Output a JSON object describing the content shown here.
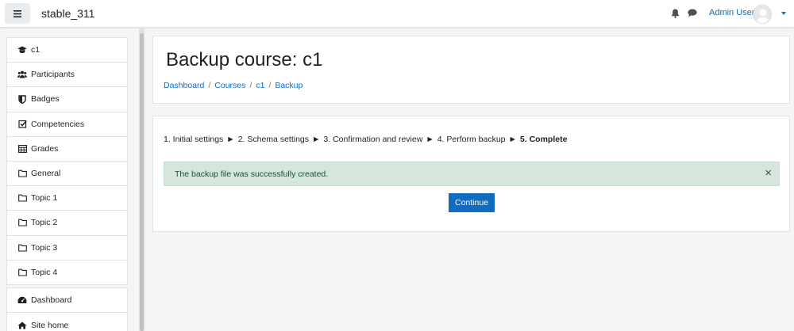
{
  "navbar": {
    "site_name": "stable_311",
    "menu_icon": "hamburger-icon",
    "notification_icon": "bell-icon",
    "messages_icon": "chat-icon",
    "user_name": "Admin User",
    "avatar_icon": "user-avatar-icon",
    "dropdown_icon": "caret-down-icon"
  },
  "sidebar": {
    "course_items": [
      {
        "label": "c1",
        "icon": "graduation-cap-icon"
      },
      {
        "label": "Participants",
        "icon": "users-icon"
      },
      {
        "label": "Badges",
        "icon": "shield-icon"
      },
      {
        "label": "Competencies",
        "icon": "check-square-icon"
      },
      {
        "label": "Grades",
        "icon": "table-icon"
      },
      {
        "label": "General",
        "icon": "folder-icon"
      },
      {
        "label": "Topic 1",
        "icon": "folder-icon"
      },
      {
        "label": "Topic 2",
        "icon": "folder-icon"
      },
      {
        "label": "Topic 3",
        "icon": "folder-icon"
      },
      {
        "label": "Topic 4",
        "icon": "folder-icon"
      }
    ],
    "site_items": [
      {
        "label": "Dashboard",
        "icon": "dashboard-icon"
      },
      {
        "label": "Site home",
        "icon": "home-icon"
      }
    ]
  },
  "header": {
    "title": "Backup course: c1",
    "breadcrumb": [
      "Dashboard",
      "Courses",
      "c1",
      "Backup"
    ],
    "breadcrumb_separator": "/"
  },
  "main": {
    "steps": [
      "1. Initial settings",
      "2. Schema settings",
      "3. Confirmation and review",
      "4. Perform backup",
      "5. Complete"
    ],
    "step_arrow": "►",
    "alert_text": "The backup file was successfully created.",
    "alert_close": "×",
    "continue_label": "Continue"
  },
  "colors": {
    "accent": "#0f6cbf",
    "alert_bg": "#d7e6dd",
    "alert_text": "#1c4f2e"
  }
}
